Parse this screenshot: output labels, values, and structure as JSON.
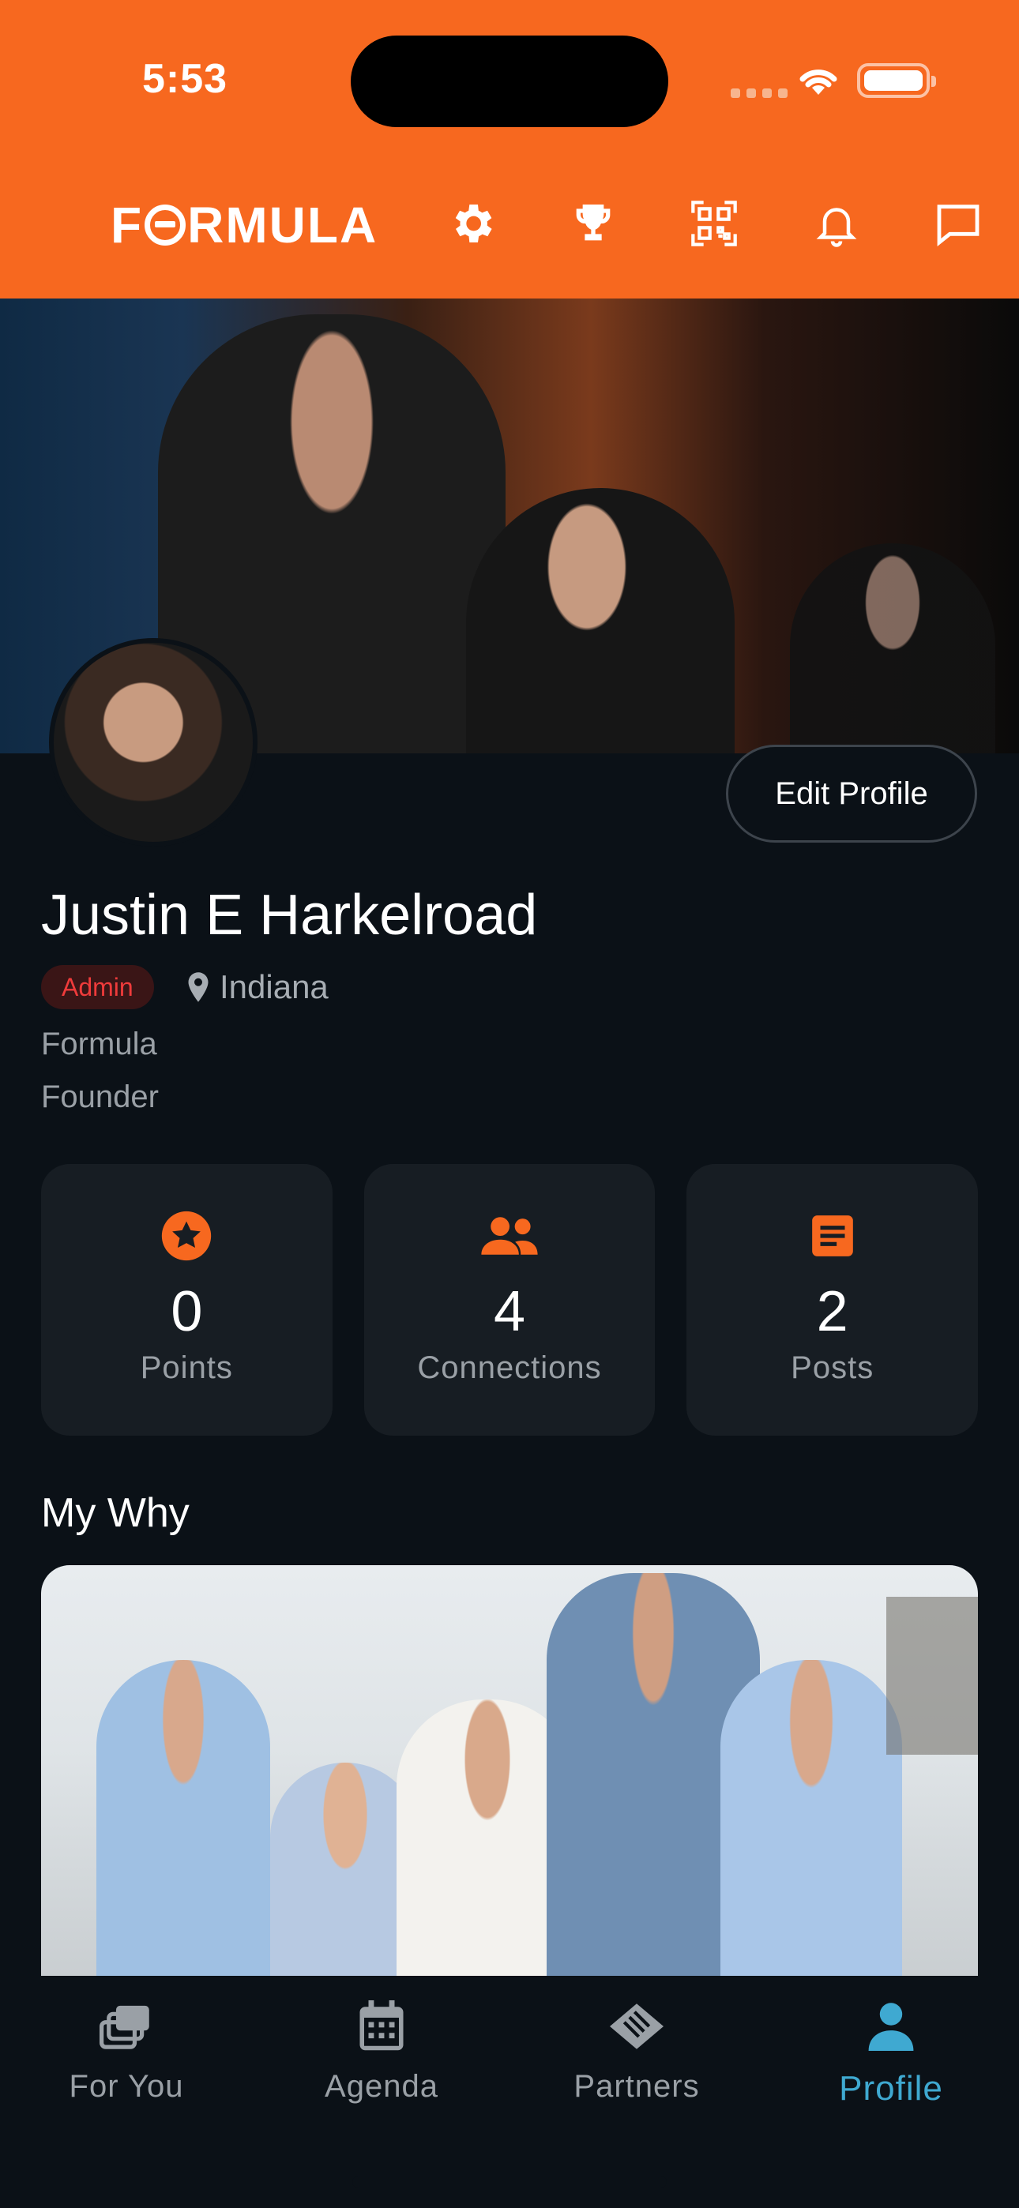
{
  "status_bar": {
    "time": "5:53"
  },
  "header": {
    "logo_text": "FORMULA",
    "icons": [
      "settings-icon",
      "trophy-icon",
      "qr-code-icon",
      "bell-icon",
      "message-icon"
    ]
  },
  "profile": {
    "edit_button_label": "Edit Profile",
    "name": "Justin E Harkelroad",
    "role_badge": "Admin",
    "location": "Indiana",
    "company": "Formula",
    "title": "Founder"
  },
  "stats": [
    {
      "icon": "star-badge-icon",
      "value": "0",
      "label": "Points"
    },
    {
      "icon": "people-icon",
      "value": "4",
      "label": "Connections"
    },
    {
      "icon": "document-icon",
      "value": "2",
      "label": "Posts"
    }
  ],
  "my_why": {
    "title": "My Why"
  },
  "tabbar": {
    "items": [
      {
        "label": "For You",
        "icon": "for-you-icon",
        "active": false
      },
      {
        "label": "Agenda",
        "icon": "calendar-icon",
        "active": false
      },
      {
        "label": "Partners",
        "icon": "handshake-icon",
        "active": false
      },
      {
        "label": "Profile",
        "icon": "profile-icon",
        "active": true
      }
    ]
  },
  "colors": {
    "brand": "#f7681f",
    "background": "#0b1117",
    "card": "#171d23",
    "active_tab": "#3fa9d1",
    "admin": "#ef3b3b"
  }
}
